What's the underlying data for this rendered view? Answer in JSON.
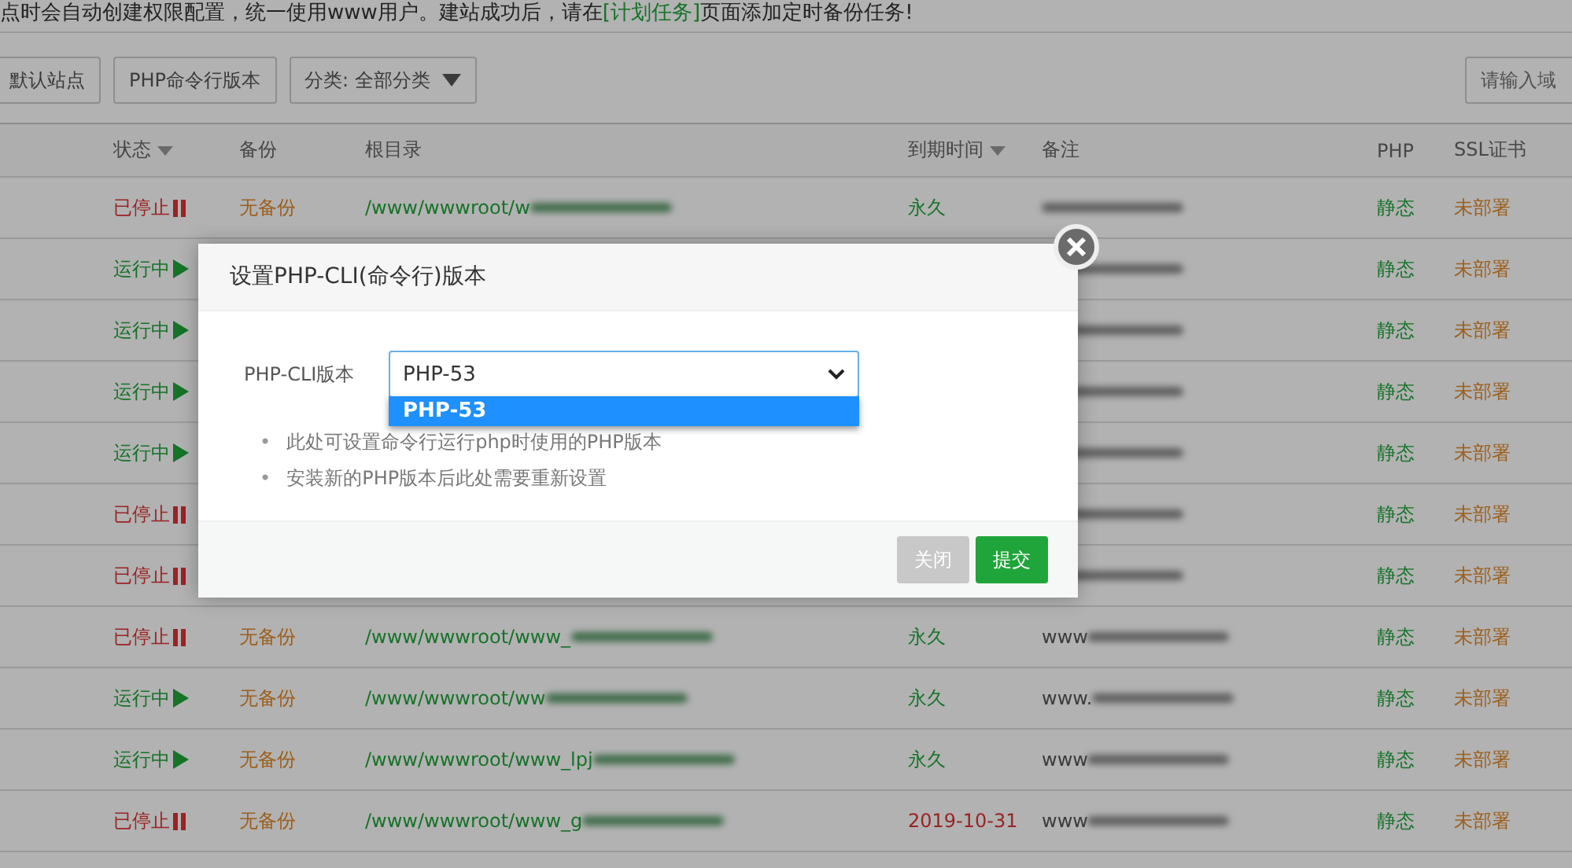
{
  "notice": {
    "before": "点时会自动创建权限配置，统一使用www用户。建站成功后，请在",
    "link": "[计划任务]",
    "after": "页面添加定时备份任务!"
  },
  "toolbar": {
    "buttons": [
      {
        "label": "默认站点",
        "kind": "plain"
      },
      {
        "label": "PHP命令行版本",
        "kind": "plain"
      },
      {
        "label": "分类: 全部分类",
        "kind": "dropdown"
      }
    ],
    "search": {
      "placeholder": "请输入域"
    }
  },
  "table": {
    "columns": [
      {
        "label": "状态",
        "sortable": true
      },
      {
        "label": "备份",
        "sortable": false
      },
      {
        "label": "根目录",
        "sortable": false
      },
      {
        "label": "到期时间",
        "sortable": true
      },
      {
        "label": "备注",
        "sortable": false
      },
      {
        "label": "PHP",
        "sortable": false
      },
      {
        "label": "SSL证书",
        "sortable": false
      }
    ],
    "rows": [
      {
        "running": false,
        "status": "已停止",
        "backup": "无备份",
        "path": "/www/wwwroot/w",
        "expiry": "永久",
        "overdue": false,
        "php": "静态",
        "ssl": "未部署"
      },
      {
        "running": true,
        "status": "运行中",
        "php": "静态",
        "ssl": "未部署"
      },
      {
        "running": true,
        "status": "运行中",
        "php": "静态",
        "ssl": "未部署"
      },
      {
        "running": true,
        "status": "运行中",
        "php": "静态",
        "ssl": "未部署"
      },
      {
        "running": true,
        "status": "运行中",
        "php": "静态",
        "ssl": "未部署"
      },
      {
        "running": false,
        "status": "已停止",
        "php": "静态",
        "ssl": "未部署"
      },
      {
        "running": false,
        "status": "已停止",
        "php": "静态",
        "ssl": "未部署"
      },
      {
        "running": false,
        "status": "已停止",
        "backup": "无备份",
        "path": "/www/wwwroot/www_",
        "expiry": "永久",
        "overdue": false,
        "note": "www",
        "php": "静态",
        "ssl": "未部署"
      },
      {
        "running": true,
        "status": "运行中",
        "backup": "无备份",
        "path": "/www/wwwroot/ww",
        "expiry": "永久",
        "overdue": false,
        "note": "www.",
        "php": "静态",
        "ssl": "未部署"
      },
      {
        "running": true,
        "status": "运行中",
        "backup": "无备份",
        "path": "/www/wwwroot/www_lpj",
        "expiry": "永久",
        "overdue": false,
        "note": "www",
        "php": "静态",
        "ssl": "未部署"
      },
      {
        "running": false,
        "status": "已停止",
        "backup": "无备份",
        "path": "/www/wwwroot/www_g",
        "expiry": "2019-10-31",
        "overdue": true,
        "note": "www",
        "php": "静态",
        "ssl": "未部署"
      }
    ]
  },
  "modal": {
    "title": "设置PHP-CLI(命令行)版本",
    "field_label": "PHP-CLI版本",
    "select": {
      "value": "PHP-53",
      "options": [
        {
          "label": "PHP-53",
          "selected": true
        }
      ]
    },
    "notes": [
      {
        "bullet": "•",
        "text": "此处可设置命令行运行php时使用的PHP版本"
      },
      {
        "bullet": "•",
        "text": "安装新的PHP版本后此处需要重新设置"
      }
    ],
    "buttons": [
      {
        "label": "关闭",
        "kind": "secondary"
      },
      {
        "label": "提交",
        "kind": "primary"
      }
    ]
  }
}
